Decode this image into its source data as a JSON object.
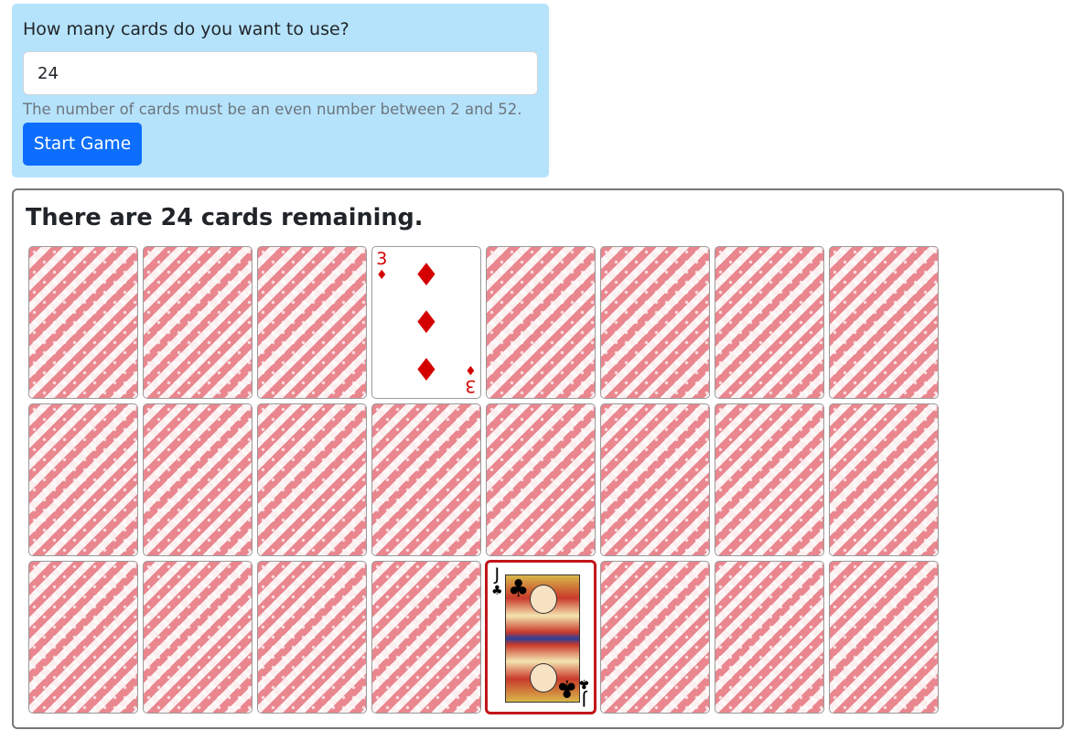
{
  "setup": {
    "question": "How many cards do you want to use?",
    "card_count_value": "24",
    "help_text": "The number of cards must be an even number between 2 and 52.",
    "start_button_label": "Start Game"
  },
  "board": {
    "remaining_text": "There are 24 cards remaining.",
    "cards": [
      {
        "state": "back"
      },
      {
        "state": "back"
      },
      {
        "state": "back"
      },
      {
        "state": "face-up",
        "rank": "3",
        "suit": "♦",
        "suit_name": "diamonds",
        "color": "red"
      },
      {
        "state": "back"
      },
      {
        "state": "back"
      },
      {
        "state": "back"
      },
      {
        "state": "back"
      },
      {
        "state": "back"
      },
      {
        "state": "back"
      },
      {
        "state": "back"
      },
      {
        "state": "back"
      },
      {
        "state": "back"
      },
      {
        "state": "back"
      },
      {
        "state": "back"
      },
      {
        "state": "back"
      },
      {
        "state": "back"
      },
      {
        "state": "back"
      },
      {
        "state": "back"
      },
      {
        "state": "back"
      },
      {
        "state": "face-up",
        "rank": "J",
        "suit": "♣",
        "suit_name": "clubs",
        "color": "black",
        "selected": true
      },
      {
        "state": "back"
      },
      {
        "state": "back"
      },
      {
        "state": "back"
      }
    ]
  },
  "colors": {
    "panel_bg": "#b6e3fc",
    "button_bg": "#0d6efd",
    "selected_border": "#c0161a",
    "card_back_pattern": "#e6737d"
  }
}
